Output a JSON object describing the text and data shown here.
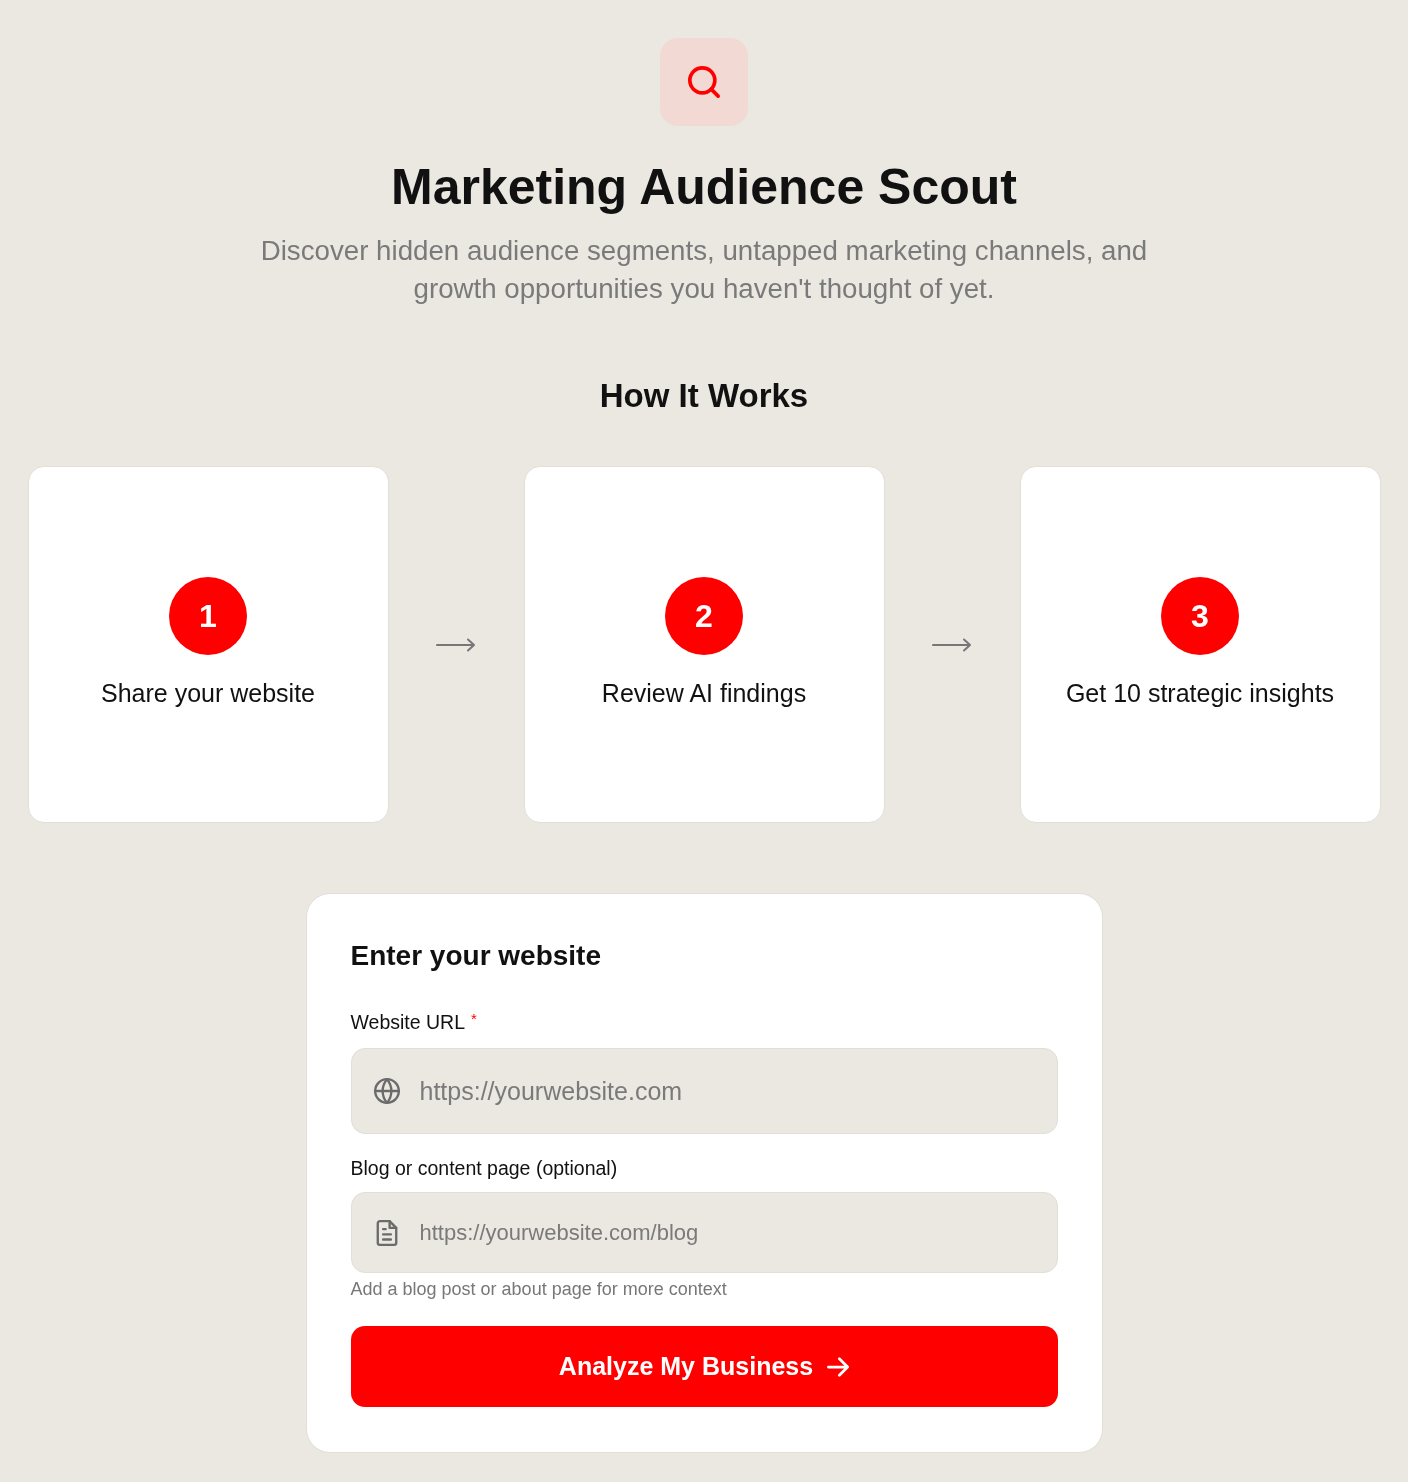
{
  "header": {
    "title": "Marketing Audience Scout",
    "subtitle": "Discover hidden audience segments, untapped marketing channels, and growth opportunities you haven't thought of yet."
  },
  "how_it_works": {
    "title": "How It Works",
    "steps": [
      {
        "number": "1",
        "label": "Share your website"
      },
      {
        "number": "2",
        "label": "Review AI findings"
      },
      {
        "number": "3",
        "label": "Get 10 strategic insights"
      }
    ]
  },
  "form": {
    "title": "Enter your website",
    "fields": [
      {
        "label": "Website URL",
        "required_mark": "*",
        "placeholder": "https://yourwebsite.com"
      },
      {
        "label": "Blog or content page (optional)",
        "placeholder": "https://yourwebsite.com/blog",
        "hint": "Add a blog post or about page for more context"
      }
    ],
    "submit": "Analyze My Business"
  }
}
